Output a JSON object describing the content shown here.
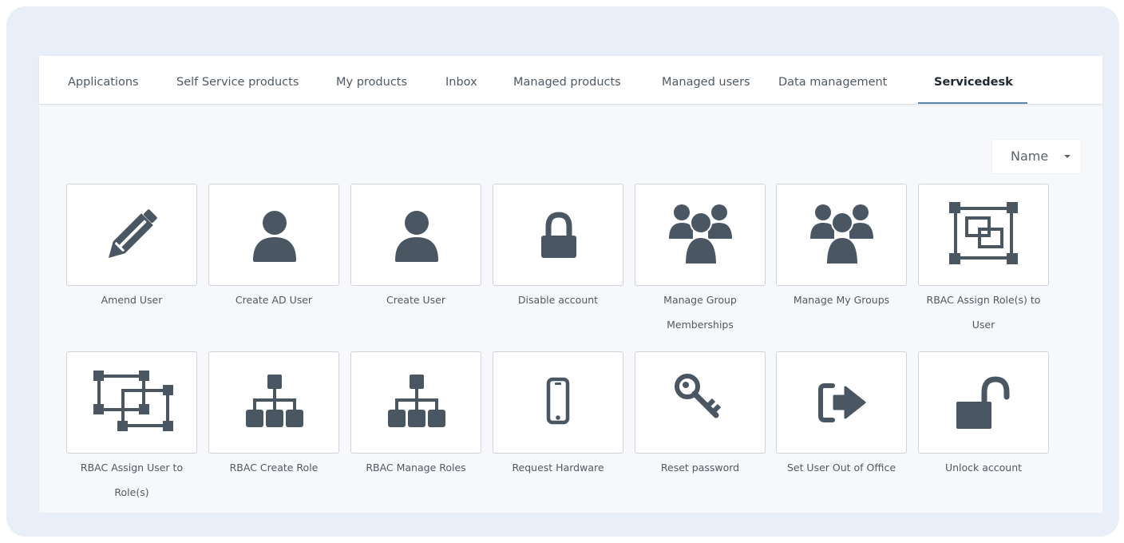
{
  "nav": {
    "tabs": [
      {
        "label": "Applications",
        "active": false
      },
      {
        "label": "Self Service products",
        "active": false
      },
      {
        "label": "My products",
        "active": false
      },
      {
        "label": "Inbox",
        "active": false
      },
      {
        "label": "Managed products",
        "active": false
      },
      {
        "label": "Managed users",
        "active": false
      },
      {
        "label": "Data management",
        "active": false
      },
      {
        "label": "Servicedesk",
        "active": true
      }
    ]
  },
  "sort": {
    "label": "Name"
  },
  "tiles": [
    {
      "label": "Amend User",
      "icon": "pencil-icon"
    },
    {
      "label": "Create AD User",
      "icon": "user-icon"
    },
    {
      "label": "Create User",
      "icon": "user-icon"
    },
    {
      "label": "Disable account",
      "icon": "lock-icon"
    },
    {
      "label": "Manage Group Memberships",
      "icon": "users-group-icon"
    },
    {
      "label": "Manage My Groups",
      "icon": "users-group-icon"
    },
    {
      "label": "RBAC Assign Role(s) to User",
      "icon": "object-group-icon"
    },
    {
      "label": "RBAC Assign User to Role(s)",
      "icon": "object-ungroup-icon"
    },
    {
      "label": "RBAC Create Role",
      "icon": "sitemap-icon"
    },
    {
      "label": "RBAC Manage Roles",
      "icon": "sitemap-icon"
    },
    {
      "label": "Request Hardware",
      "icon": "mobile-icon"
    },
    {
      "label": "Reset password",
      "icon": "key-icon"
    },
    {
      "label": "Set User Out of Office",
      "icon": "sign-out-icon"
    },
    {
      "label": "Unlock account",
      "icon": "unlock-icon"
    }
  ],
  "colors": {
    "icon": "#4a5661",
    "active_tab_underline": "#5b86a8",
    "background": "#e8eff8"
  }
}
